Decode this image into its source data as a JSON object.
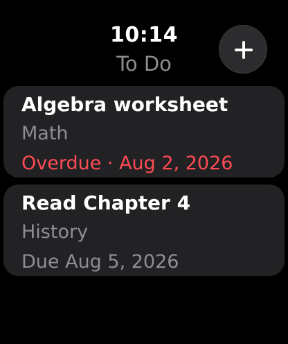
{
  "header": {
    "time": "10:14",
    "title": "To Do",
    "add_icon": "plus-icon"
  },
  "colors": {
    "background": "#000000",
    "card": "#222224",
    "primary_text": "#ffffff",
    "secondary_text": "#8e8e93",
    "overdue": "#ff4b55"
  },
  "tasks": [
    {
      "title": "Algebra worksheet",
      "subject": "Math",
      "due": "Overdue · Aug 2, 2026",
      "overdue": true
    },
    {
      "title": "Read Chapter 4",
      "subject": "History",
      "due": "Due Aug 5, 2026",
      "overdue": false
    }
  ]
}
